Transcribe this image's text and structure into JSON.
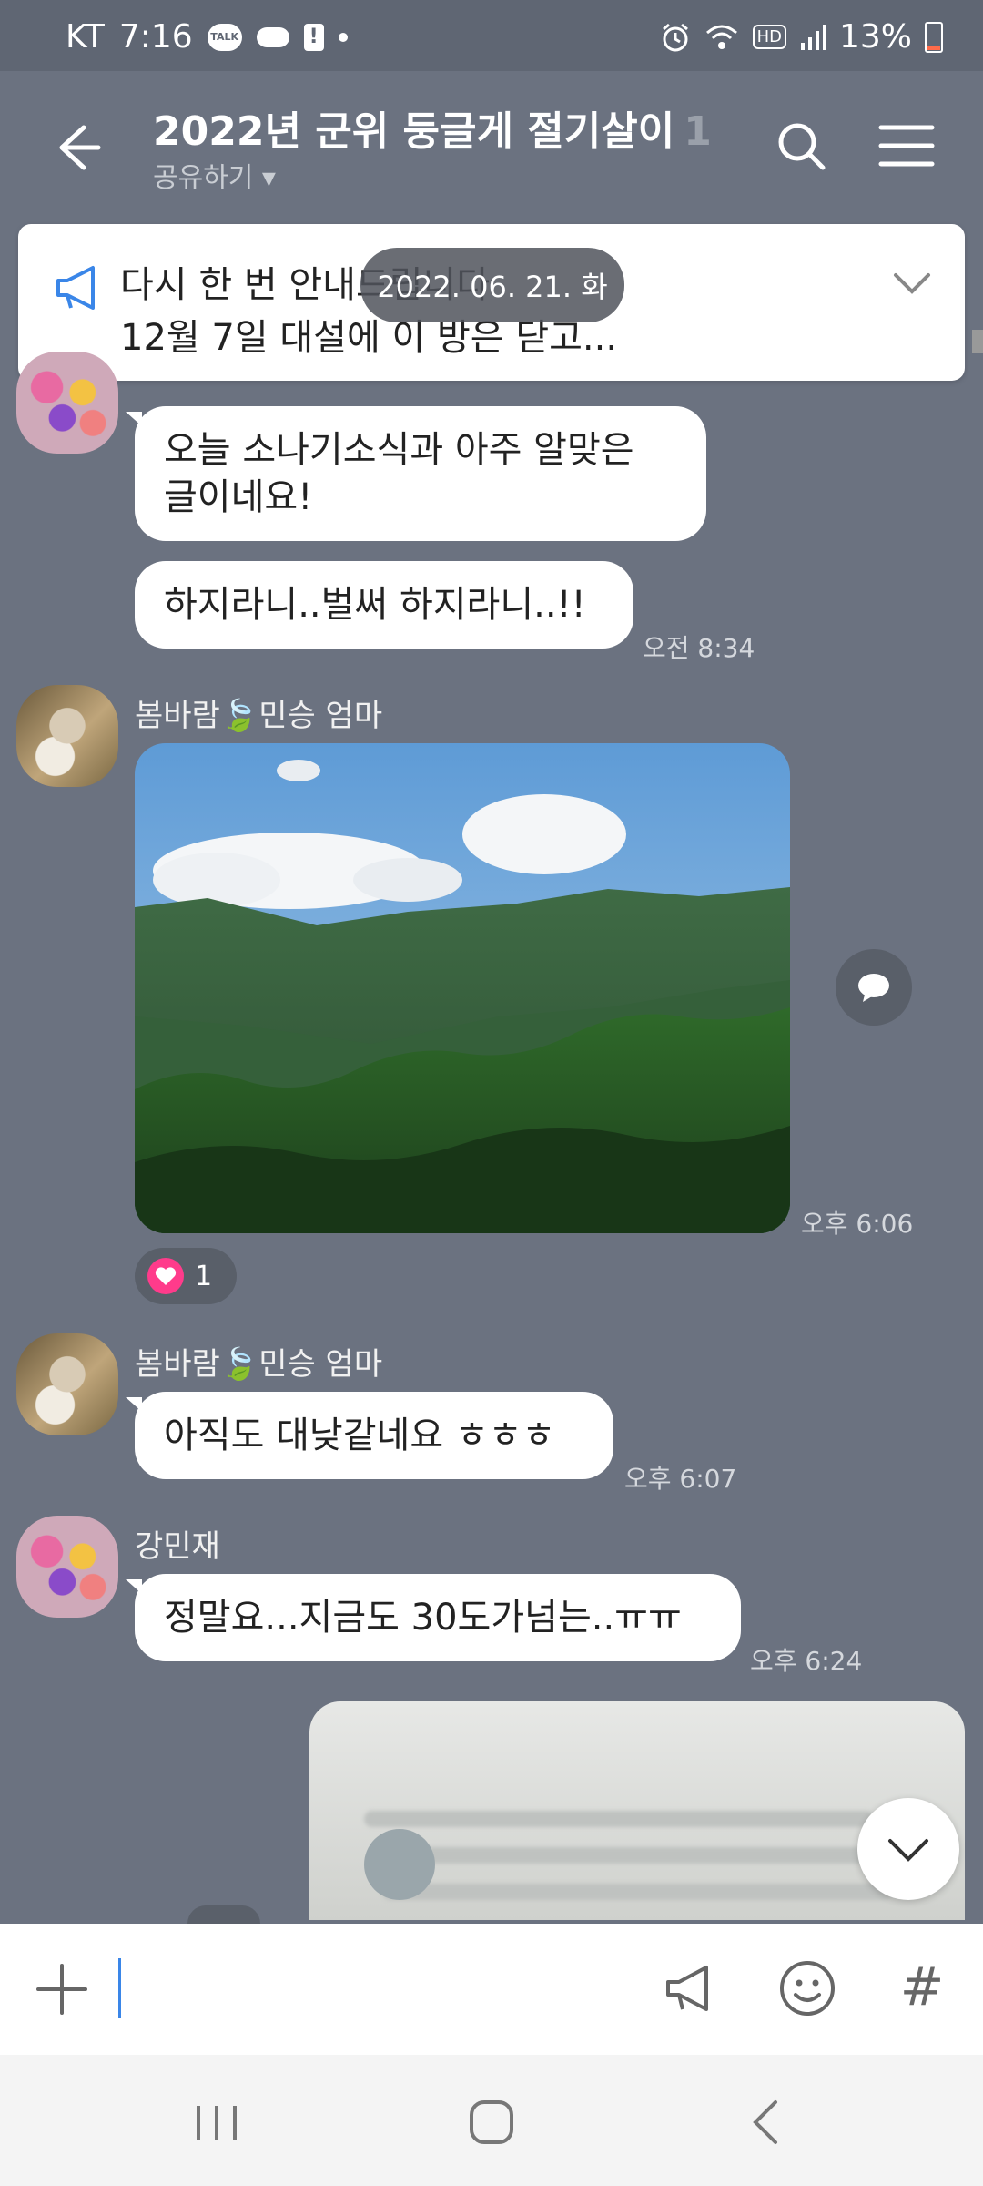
{
  "status_bar": {
    "carrier": "KT",
    "time": "7:16",
    "talk_badge": "TALK",
    "alert_glyph": "!",
    "hd_label": "HD",
    "battery": "13%"
  },
  "header": {
    "title": "2022년 군위 둥글게 절기살이",
    "count": "1",
    "share_label": "공유하기 ▾"
  },
  "notice": {
    "line1": "다시 한 번 안내드립니다",
    "line2": "12월 7일 대설에 이 방은 닫고..."
  },
  "date_pill": "2022. 06. 21. 화",
  "messages": [
    {
      "text": "오늘 소나기소식과 아주 알맞은\n글이네요!"
    },
    {
      "text": "하지라니..벌써 하지라니..!!",
      "time": "오전 8:34"
    },
    {
      "sender_prefix": "봄바람",
      "sender_leaf": "🍃",
      "sender_suffix": "민승 엄마",
      "time": "오후 6:06",
      "reaction_count": "1"
    },
    {
      "sender_prefix": "봄바람",
      "sender_leaf": "🍃",
      "sender_suffix": "민승 엄마",
      "text": "아직도 대낮같네요 ㅎㅎㅎ",
      "time": "오후 6:07"
    },
    {
      "sender": "강민재",
      "text": "정말요...지금도 30도가넘는..ㅠㅠ",
      "time": "오후 6:24"
    }
  ],
  "input": {
    "placeholder": "",
    "hash_label": "#"
  },
  "colors": {
    "chat_bg": "#6b7280",
    "bubble": "#ffffff",
    "heart": "#ff3b8b",
    "cursor": "#3a86e8"
  }
}
